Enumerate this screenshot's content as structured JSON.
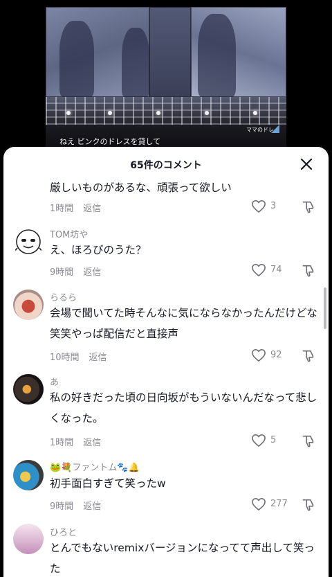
{
  "video": {
    "caption": "ねえ ピンクのドレスを貸して",
    "watermark": "ママのドレ"
  },
  "sheet": {
    "title": "65件のコメント"
  },
  "comments": [
    {
      "username": "",
      "text": "厳しいものがあるな、頑張って欲しい",
      "time": "1時間",
      "reply": "返信",
      "likes": "3"
    },
    {
      "username": "TOM坊や",
      "text": "え、ほろびのうた？",
      "time": "9時間",
      "reply": "返信",
      "likes": "74"
    },
    {
      "username": "らるら",
      "text": "会場で聞いてた時そんなに気にならなかったんだけどな笑笑やっぱ配信だと直接声",
      "time": "10時間",
      "reply": "返信",
      "likes": "92"
    },
    {
      "username": "あ",
      "text": "私の好きだった頃の日向坂がもういないんだなって悲しくなった。",
      "time": "1時間",
      "reply": "返信",
      "likes": "5"
    },
    {
      "username": "🐸💐ファントム🐾🔔",
      "text": "初手面白すぎて笑ったw",
      "time": "9時間",
      "reply": "返信",
      "likes": "277"
    },
    {
      "username": "ひろと",
      "text": "とんでもないremixバージョンになってて声出して笑った",
      "time": "",
      "reply": "",
      "likes": ""
    }
  ],
  "colors": {
    "text": "#161823",
    "secondary": "#8a8b91",
    "sheet_bg": "#ffffff"
  },
  "icons": {
    "close": "close-icon",
    "like": "heart-outline-icon",
    "dislike": "thumbs-down-icon"
  }
}
